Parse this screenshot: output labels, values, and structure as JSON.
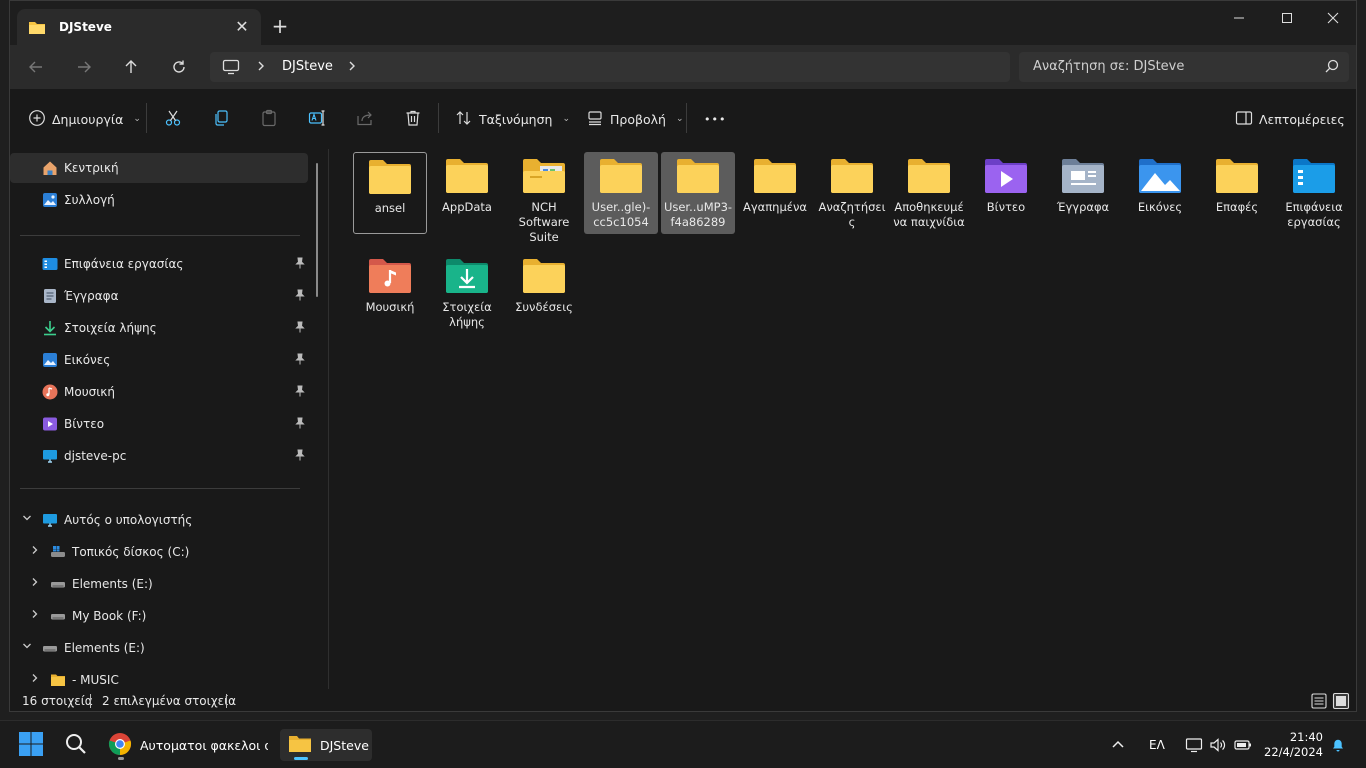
{
  "window": {
    "tab_title": "DJSteve",
    "close_tab": "✕",
    "new_tab": "+"
  },
  "address": {
    "breadcrumb": "DJSteve",
    "search_placeholder": "Αναζήτηση σε: DJSteve"
  },
  "commands": {
    "new_label": "Δημιουργία",
    "sort_label": "Ταξινόμηση",
    "view_label": "Προβολή",
    "more_label": "•••",
    "details_label": "Λεπτομέρειες"
  },
  "nav": {
    "home": "Κεντρική",
    "gallery": "Συλλογή",
    "pinned": [
      {
        "label": "Επιφάνεια εργασίας",
        "icon": "desktop-icon"
      },
      {
        "label": "Έγγραφα",
        "icon": "documents-icon"
      },
      {
        "label": "Στοιχεία λήψης",
        "icon": "downloads-icon"
      },
      {
        "label": "Εικόνες",
        "icon": "pictures-icon"
      },
      {
        "label": "Μουσική",
        "icon": "music-icon"
      },
      {
        "label": "Βίντεο",
        "icon": "videos-icon"
      },
      {
        "label": "djsteve-pc",
        "icon": "computer-icon"
      }
    ],
    "this_pc": "Αυτός ο υπολογιστής",
    "drives": [
      {
        "label": "Τοπικός δίσκος (C:)"
      },
      {
        "label": "Elements (E:)"
      },
      {
        "label": "My Book (F:)"
      }
    ],
    "elements_root": "Elements (E:)",
    "music_folder": "- MUSIC"
  },
  "files": [
    {
      "name": "ansel",
      "type": "folder",
      "state": "focus"
    },
    {
      "name": "AppData",
      "type": "folder",
      "state": ""
    },
    {
      "name": "NCH Software Suite",
      "type": "nch",
      "state": ""
    },
    {
      "name": "User..gle)-cc5c1054",
      "type": "folder",
      "state": "selected"
    },
    {
      "name": "User..uMP3-f4a86289",
      "type": "folder",
      "state": "selected"
    },
    {
      "name": "Αγαπημένα",
      "type": "folder",
      "state": ""
    },
    {
      "name": "Αναζητήσεις",
      "type": "folder",
      "state": ""
    },
    {
      "name": "Αποθηκευμένα παιχνίδια",
      "type": "folder",
      "state": ""
    },
    {
      "name": "Βίντεο",
      "type": "videos",
      "state": ""
    },
    {
      "name": "Έγγραφα",
      "type": "documents",
      "state": ""
    },
    {
      "name": "Εικόνες",
      "type": "pictures",
      "state": ""
    },
    {
      "name": "Επαφές",
      "type": "folder",
      "state": ""
    },
    {
      "name": "Επιφάνεια εργασίας",
      "type": "desktop",
      "state": ""
    },
    {
      "name": "Μουσική",
      "type": "music",
      "state": ""
    },
    {
      "name": "Στοιχεία λήψης",
      "type": "downloads",
      "state": ""
    },
    {
      "name": "Συνδέσεις",
      "type": "folder",
      "state": ""
    }
  ],
  "status": {
    "item_count": "16 στοιχεία",
    "selected_count": "2 επιλεγμένα στοιχεία"
  },
  "taskbar": {
    "chrome_label": "Αυτοματοι φακελοι στο",
    "explorer_label": "DJSteve",
    "language": "ΕΛ",
    "time": "21:40",
    "date": "22/4/2024"
  },
  "colors": {
    "folder": "#f6c443",
    "accent": "#4cc2ff",
    "selection": "#5c5c5c"
  }
}
